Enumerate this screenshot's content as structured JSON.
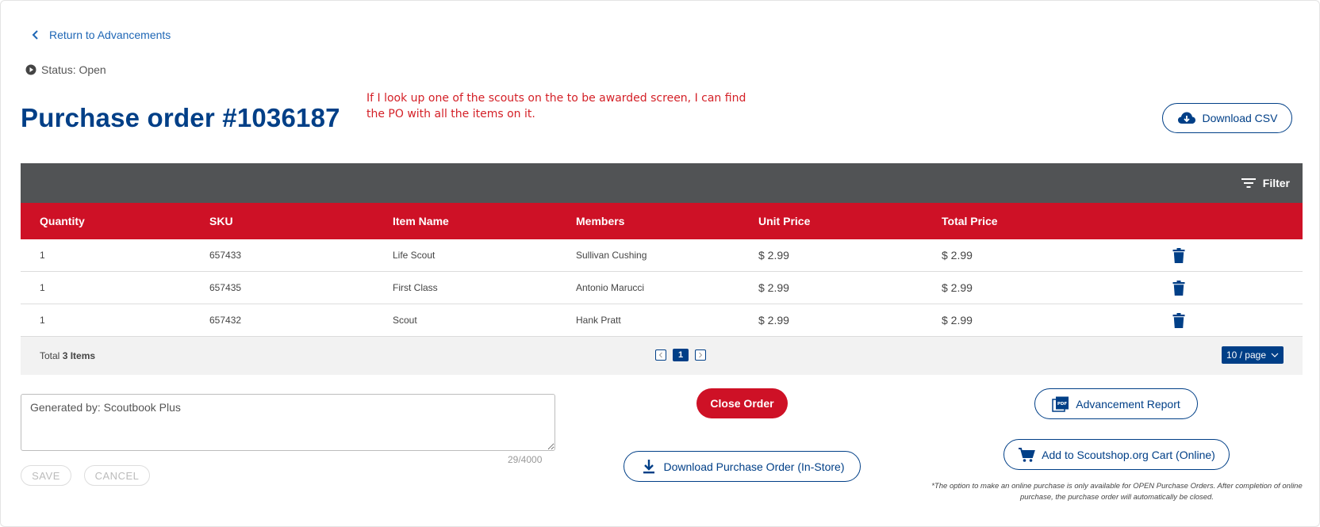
{
  "nav": {
    "back_label": "Return to Advancements"
  },
  "status": {
    "text": "Status: Open"
  },
  "page": {
    "title": "Purchase order #1036187"
  },
  "annotation": {
    "text": "If I look up one of the scouts on the to be awarded screen, I can find the PO with all the items on it."
  },
  "toolbar": {
    "download_csv_label": "Download CSV",
    "filter_label": "Filter"
  },
  "table": {
    "headers": {
      "quantity": "Quantity",
      "sku": "SKU",
      "item_name": "Item Name",
      "members": "Members",
      "unit_price": "Unit Price",
      "total_price": "Total Price"
    },
    "rows": [
      {
        "quantity": "1",
        "sku": "657433",
        "item_name": "Life Scout",
        "members": "Sullivan Cushing",
        "unit_price": "$ 2.99",
        "total_price": "$ 2.99"
      },
      {
        "quantity": "1",
        "sku": "657435",
        "item_name": "First Class",
        "members": "Antonio Marucci",
        "unit_price": "$ 2.99",
        "total_price": "$ 2.99"
      },
      {
        "quantity": "1",
        "sku": "657432",
        "item_name": "Scout",
        "members": "Hank Pratt",
        "unit_price": "$ 2.99",
        "total_price": "$ 2.99"
      }
    ],
    "footer": {
      "total_prefix": "Total",
      "total_count": "3 Items",
      "current_page": "1",
      "per_page": "10 / page"
    }
  },
  "notes": {
    "value": "Generated by: Scoutbook Plus",
    "counter": "29/4000",
    "save_label": "SAVE",
    "cancel_label": "CANCEL"
  },
  "actions": {
    "close_order": "Close Order",
    "download_po": "Download Purchase Order (In-Store)",
    "advancement_report": "Advancement Report",
    "add_to_cart": "Add to Scoutshop.org Cart (Online)",
    "disclaimer": "*The option to make an online purchase is only available for OPEN Purchase Orders. After completion of online purchase, the purchase order will automatically be closed."
  },
  "colors": {
    "brand_blue": "#003f87",
    "brand_red": "#ce1126",
    "filter_bar": "#515355",
    "link_blue": "#1e66b5",
    "annotation_red": "#d42027"
  }
}
